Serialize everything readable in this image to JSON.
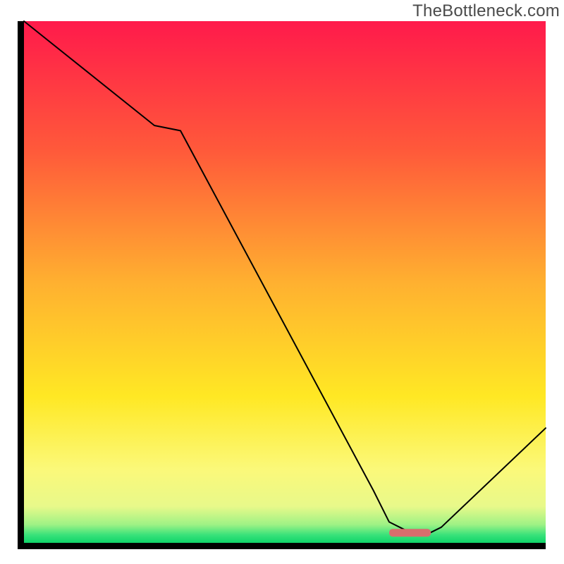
{
  "watermark": "TheBottleneck.com",
  "chart_data": {
    "type": "line",
    "title": "",
    "xlabel": "",
    "ylabel": "",
    "xlim": [
      0,
      100
    ],
    "ylim": [
      0,
      100
    ],
    "x": [
      0,
      5,
      25,
      30,
      67,
      70,
      74,
      78,
      80,
      100
    ],
    "values": [
      100,
      96,
      80,
      79,
      10,
      4,
      2,
      2,
      3,
      22
    ],
    "marker": {
      "x_start": 70,
      "x_end": 78,
      "y": 2,
      "color": "#d96d6d"
    },
    "gradient_stops": [
      {
        "offset": 0.0,
        "color": "#ff1a4b"
      },
      {
        "offset": 0.25,
        "color": "#ff5a3a"
      },
      {
        "offset": 0.5,
        "color": "#ffb030"
      },
      {
        "offset": 0.72,
        "color": "#ffe824"
      },
      {
        "offset": 0.86,
        "color": "#fbf97a"
      },
      {
        "offset": 0.93,
        "color": "#e8f98a"
      },
      {
        "offset": 0.965,
        "color": "#9ef285"
      },
      {
        "offset": 0.985,
        "color": "#38e27a"
      },
      {
        "offset": 1.0,
        "color": "#0fd469"
      }
    ],
    "line_color": "#000000",
    "line_width": 2
  }
}
